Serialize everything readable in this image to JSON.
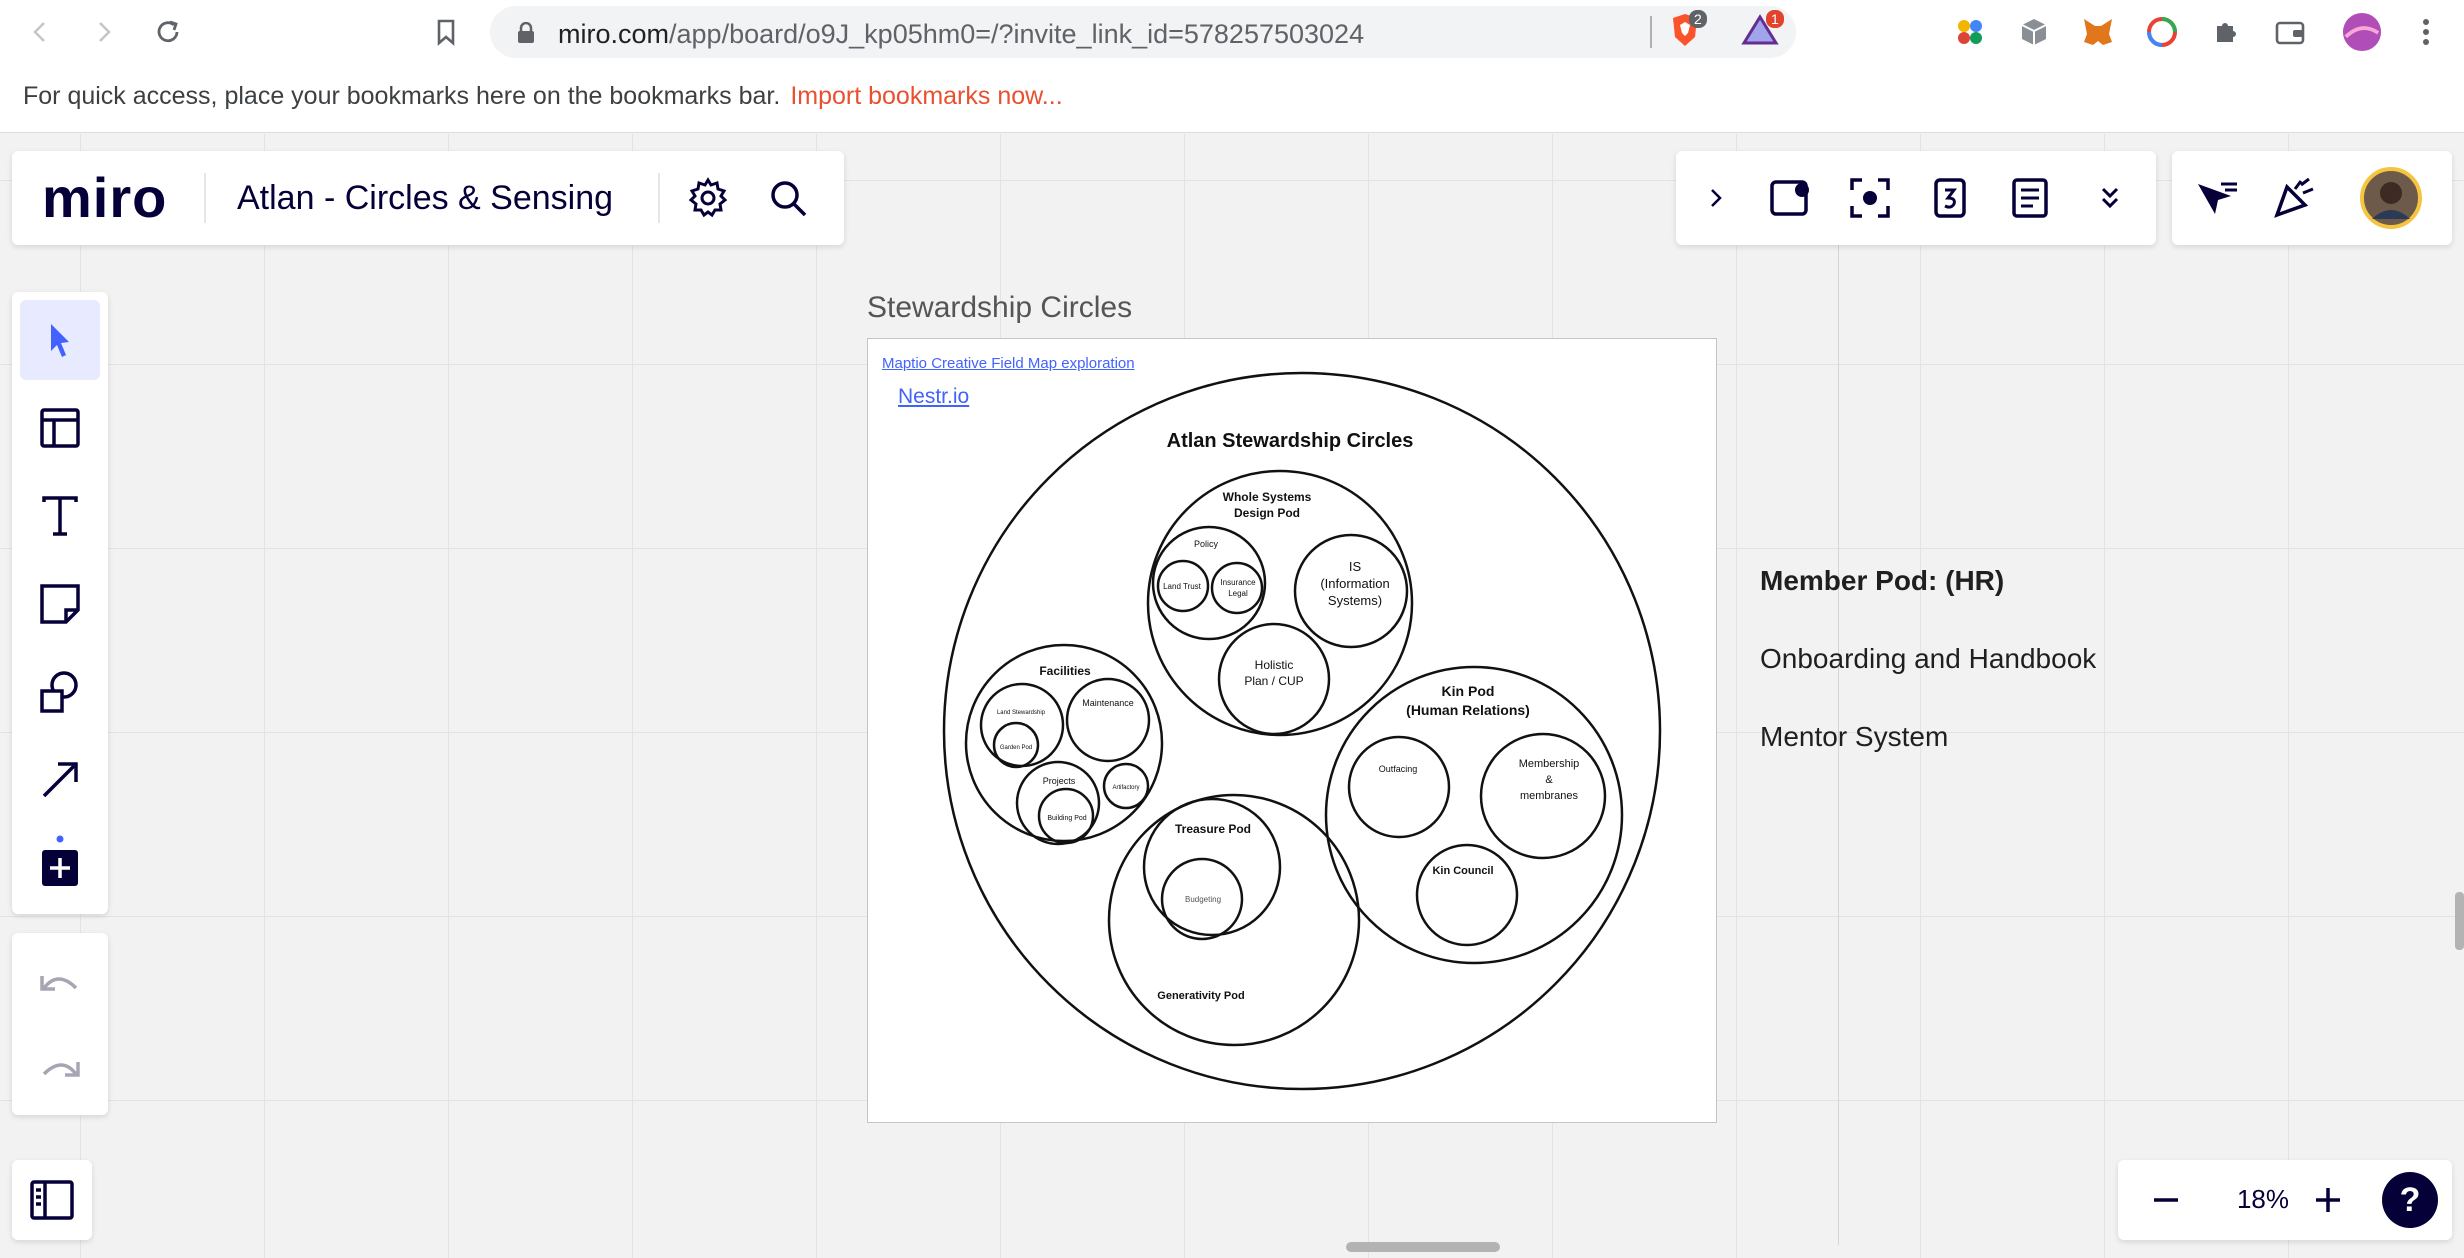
{
  "browser": {
    "url_host": "miro.com",
    "url_path": "/app/board/o9J_kp05hm0=/?invite_link_id=578257503024",
    "brave_badge": "2",
    "rewards_badge": "1"
  },
  "bookmarks_bar": {
    "message": "For quick access, place your bookmarks here on the bookmarks bar.",
    "import_link": "Import bookmarks now..."
  },
  "board": {
    "logo": "miro",
    "title": "Atlan - Circles & Sensing",
    "zoom": "18%",
    "help": "?"
  },
  "frame": {
    "title": "Stewardship Circles",
    "maptio_link": "Maptio Creative Field Map exploration",
    "nestr_link": "Nestr.io"
  },
  "circles": {
    "main_title": "Atlan Stewardship Circles",
    "whole_systems_line1": "Whole Systems",
    "whole_systems_line2": "Design Pod",
    "policy": "Policy",
    "land_trust": "Land Trust",
    "insurance_line1": "Insurance",
    "insurance_line2": "Legal",
    "is_line1": "IS",
    "is_line2": "(Information",
    "is_line3": "Systems)",
    "holistic_line1": "Holistic",
    "holistic_line2": "Plan / CUP",
    "facilities": "Facilities",
    "land_stewardship": "Land Stewardship",
    "garden_pod": "Garden Pod",
    "maintenance": "Maintenance",
    "projects": "Projects",
    "artifactory": "Artifactory",
    "building_pod": "Building Pod",
    "kin_line1": "Kin Pod",
    "kin_line2": "(Human Relations)",
    "outfacing": "Outfacing",
    "membership_line1": "Membership",
    "membership_line2": "&",
    "membership_line3": "membranes",
    "kin_council": "Kin Council",
    "treasure_pod": "Treasure Pod",
    "budgeting": "Budgeting",
    "generativity_pod": "Generativity Pod"
  },
  "member_pod": {
    "title": "Member Pod: (HR)",
    "item1": "Onboarding and Handbook",
    "item2": "Mentor System"
  }
}
